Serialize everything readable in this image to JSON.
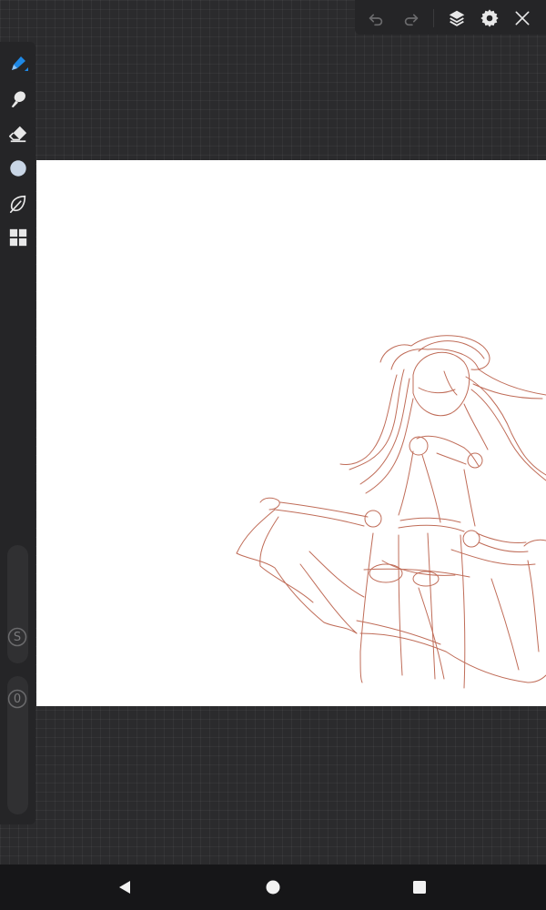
{
  "app": {
    "icons": {
      "undo": "undo-icon",
      "redo": "redo-icon",
      "layers": "layers-icon",
      "settings": "gear-icon",
      "close": "close-icon"
    },
    "tools": [
      "brush-icon",
      "smudge-icon",
      "eraser-icon",
      "color-icon",
      "leaf-icon",
      "grid-icon"
    ],
    "colors": {
      "background": "#2b2b2d",
      "panel": "#252527",
      "accent": "#1e88e5",
      "current_color": "#c9d6e6",
      "sketch_stroke": "#b5533b",
      "canvas": "#ffffff",
      "navbar": "#161618"
    }
  },
  "sliders": {
    "size_label": "S",
    "opacity_label": "0"
  },
  "navbar": {
    "icons": [
      "back-icon",
      "home-icon",
      "recents-icon"
    ]
  }
}
